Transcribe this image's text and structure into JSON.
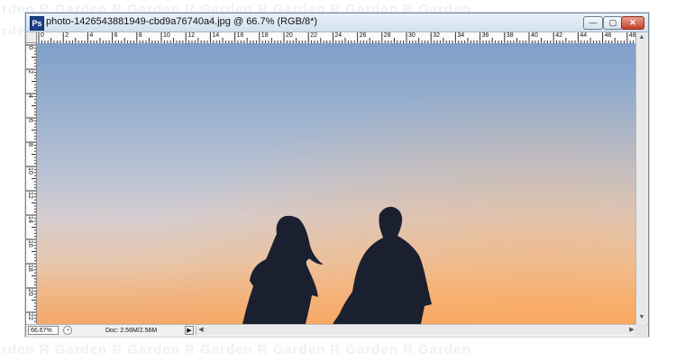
{
  "window": {
    "title": "photo-1426543881949-cbd9a76740a4.jpg @ 66.7% (RGB/8*)",
    "app_icon_letter": "Ps",
    "buttons": {
      "minimize": "—",
      "maximize": "▢",
      "close": "✕"
    }
  },
  "watermark_text": "Garden  R  Garden  R  Garden  R  Garden  R  Garden  R  Garden  R  Garden",
  "rulers": {
    "horizontal_labels": [
      "0",
      "2",
      "4",
      "6",
      "8",
      "10",
      "12",
      "14",
      "16",
      "18",
      "20",
      "22",
      "24",
      "26",
      "28",
      "30",
      "32",
      "34",
      "36",
      "38",
      "40",
      "42",
      "44",
      "46",
      "48"
    ],
    "vertical_labels": [
      "0",
      "2",
      "4",
      "6",
      "8",
      "10",
      "12",
      "14",
      "16",
      "18",
      "20",
      "22"
    ]
  },
  "status": {
    "zoom": "66.67%",
    "doc": "Doc: 2.56M/2.56M",
    "menu_arrow": "▶"
  },
  "scroll": {
    "up": "▲",
    "down": "▼",
    "left": "◀",
    "right": "▶"
  },
  "icons": {
    "app": "photoshop-icon",
    "status": "status-indicator-icon"
  },
  "colors": {
    "sky_top": "#7f9fc9",
    "sky_bottom": "#f5a868",
    "silhouette": "#1b2030"
  }
}
